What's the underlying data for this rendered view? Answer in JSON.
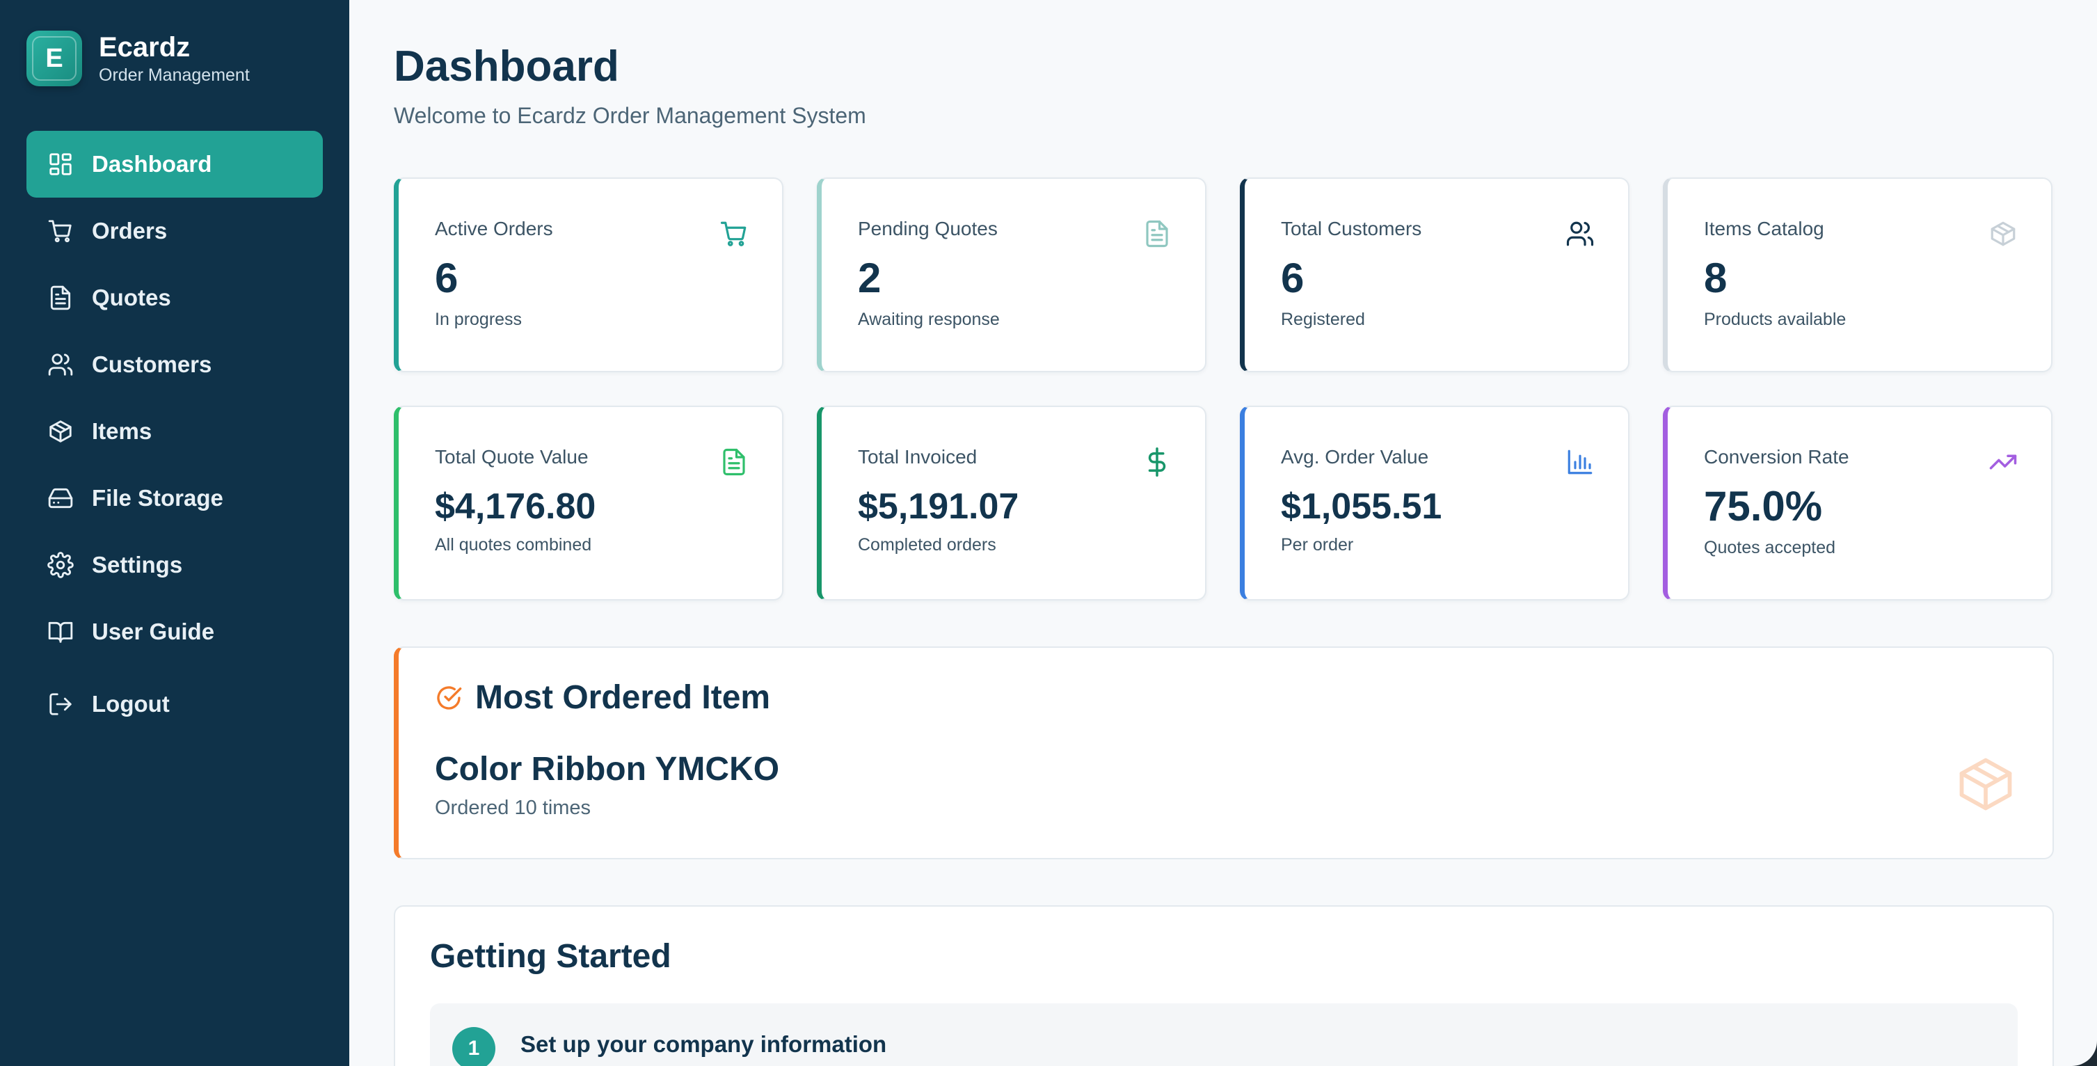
{
  "brand": {
    "logo_letter": "E",
    "name": "Ecardz",
    "subtitle": "Order Management"
  },
  "sidebar": {
    "items": [
      {
        "label": "Dashboard",
        "icon": "dashboard-icon",
        "active": true
      },
      {
        "label": "Orders",
        "icon": "cart-icon"
      },
      {
        "label": "Quotes",
        "icon": "document-icon"
      },
      {
        "label": "Customers",
        "icon": "users-icon"
      },
      {
        "label": "Items",
        "icon": "package-icon"
      },
      {
        "label": "File Storage",
        "icon": "hard-drive-icon"
      },
      {
        "label": "Settings",
        "icon": "gear-icon"
      },
      {
        "label": "User Guide",
        "icon": "book-icon"
      }
    ],
    "logout": {
      "label": "Logout",
      "icon": "logout-icon"
    }
  },
  "header": {
    "title": "Dashboard",
    "subtitle": "Welcome to Ecardz Order Management System"
  },
  "stats": [
    {
      "label": "Active Orders",
      "value": "6",
      "note": "In progress",
      "icon": "cart-icon",
      "accent": "#22a295"
    },
    {
      "label": "Pending Quotes",
      "value": "2",
      "note": "Awaiting response",
      "icon": "document-icon",
      "accent": "#9fd3cd"
    },
    {
      "label": "Total Customers",
      "value": "6",
      "note": "Registered",
      "icon": "users-icon",
      "accent": "#12344d"
    },
    {
      "label": "Items Catalog",
      "value": "8",
      "note": "Products available",
      "icon": "package-icon",
      "accent": "#d6dde3"
    },
    {
      "label": "Total Quote Value",
      "value": "$4,176.80",
      "note": "All quotes combined",
      "icon": "document-icon",
      "accent": "#2fbf6b"
    },
    {
      "label": "Total Invoiced",
      "value": "$5,191.07",
      "note": "Completed orders",
      "icon": "dollar-icon",
      "accent": "#18966a"
    },
    {
      "label": "Avg. Order Value",
      "value": "$1,055.51",
      "note": "Per order",
      "icon": "bar-chart-icon",
      "accent": "#3b7fe0"
    },
    {
      "label": "Conversion Rate",
      "value": "75.0%",
      "note": "Quotes accepted",
      "icon": "trending-up-icon",
      "accent": "#a35ee0"
    }
  ],
  "most_ordered": {
    "title": "Most Ordered Item",
    "item": "Color Ribbon YMCKO",
    "note": "Ordered 10 times",
    "accent": "#f47b2a"
  },
  "getting_started": {
    "title": "Getting Started",
    "steps": [
      {
        "number": "1",
        "title": "Set up your company information"
      }
    ]
  }
}
